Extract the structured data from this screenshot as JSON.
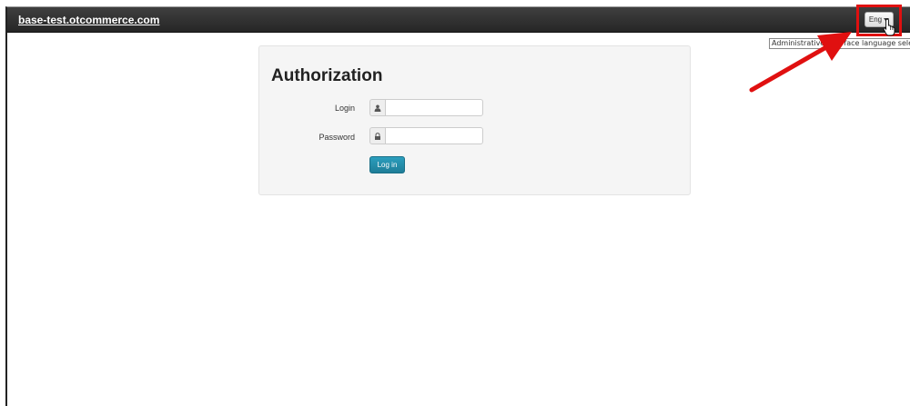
{
  "header": {
    "site_name": "base-test.otcommerce.com",
    "language_button": "Eng",
    "language_tooltip": "Administrative interface language selection"
  },
  "auth": {
    "title": "Authorization",
    "login_label": "Login",
    "login_value": "",
    "password_label": "Password",
    "password_value": "",
    "submit_label": "Log in"
  },
  "colors": {
    "topbar": "#2f2f2f",
    "primary_button": "#1e88a8",
    "highlight": "#e01010"
  },
  "icons": {
    "login": "user-icon",
    "password": "lock-icon",
    "caret": "caret-down-icon",
    "cursor": "hand-cursor-icon",
    "annotation": "red-arrow"
  }
}
